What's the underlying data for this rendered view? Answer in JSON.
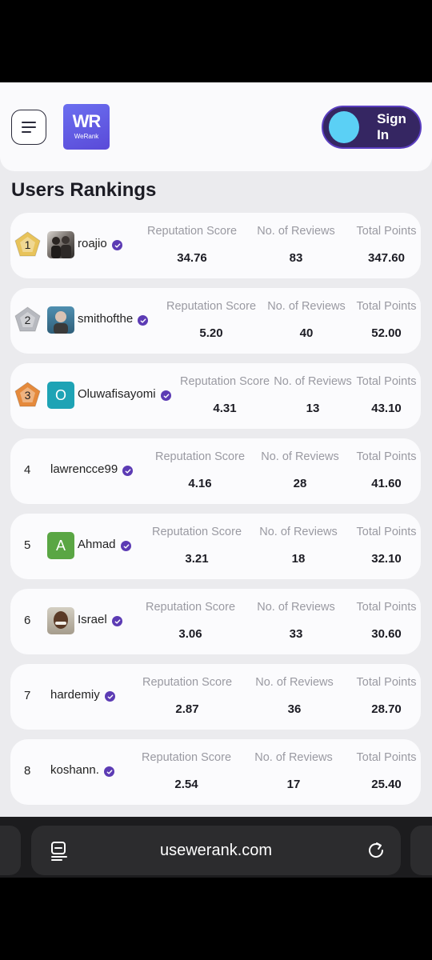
{
  "header": {
    "logo_mark": "WR",
    "logo_name": "WeRank",
    "signin_label": "Sign In"
  },
  "page_title": "Users Rankings",
  "columns": {
    "reputation": "Reputation Score",
    "reviews": "No. of Reviews",
    "points": "Total Points"
  },
  "users": [
    {
      "rank": "1",
      "name": "roajio",
      "reputation": "34.76",
      "reviews": "83",
      "points": "347.60"
    },
    {
      "rank": "2",
      "name": "smithofthe",
      "reputation": "5.20",
      "reviews": "40",
      "points": "52.00"
    },
    {
      "rank": "3",
      "name": "Oluwafisayomi",
      "avatar_letter": "O",
      "reputation": "4.31",
      "reviews": "13",
      "points": "43.10"
    },
    {
      "rank": "4",
      "name": "lawrencce99",
      "reputation": "4.16",
      "reviews": "28",
      "points": "41.60"
    },
    {
      "rank": "5",
      "name": "Ahmad",
      "avatar_letter": "A",
      "reputation": "3.21",
      "reviews": "18",
      "points": "32.10"
    },
    {
      "rank": "6",
      "name": "Israel",
      "reputation": "3.06",
      "reviews": "33",
      "points": "30.60"
    },
    {
      "rank": "7",
      "name": "hardemiy",
      "reputation": "2.87",
      "reviews": "36",
      "points": "28.70"
    },
    {
      "rank": "8",
      "name": "koshann.",
      "reputation": "2.54",
      "reviews": "17",
      "points": "25.40"
    }
  ],
  "browser": {
    "url": "usewerank.com"
  },
  "colors": {
    "gold": "#e8c35a",
    "silver": "#b7b9bf",
    "bronze": "#e58a3c",
    "verified": "#5c3bb4",
    "avatar_teal": "#1ea3b5",
    "avatar_green": "#5aa644"
  }
}
